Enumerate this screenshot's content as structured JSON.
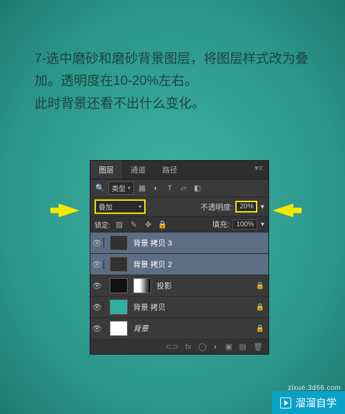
{
  "instruction": {
    "line1": "7-选中磨砂和磨砂背景图层，将图层样式改为叠加。透明度在10-20%左右。",
    "line2": "此时背景还看不出什么变化。"
  },
  "tabs": {
    "layers": "图层",
    "channels": "通道",
    "paths": "路径"
  },
  "filter": {
    "kind_label": "类型"
  },
  "blend": {
    "mode": "叠加",
    "opacity_label": "不透明度:",
    "opacity_value": "20%"
  },
  "lock": {
    "label": "锁定:",
    "fill_label": "填充:",
    "fill_value": "100%"
  },
  "layers": [
    {
      "name": "背景 拷贝 3"
    },
    {
      "name": "背景 拷贝 2"
    },
    {
      "name": "投影"
    },
    {
      "name": "背景 拷贝"
    },
    {
      "name": "背景"
    }
  ],
  "watermark": {
    "brand": "溜溜自学",
    "url": "zixue.3d66.com"
  }
}
